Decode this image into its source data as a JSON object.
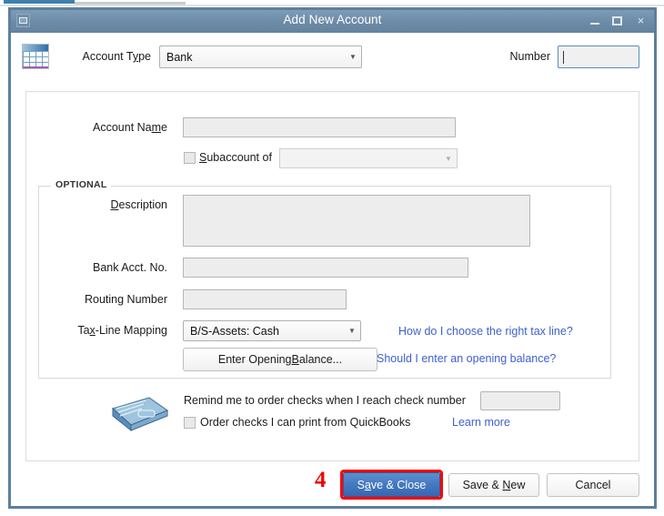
{
  "window": {
    "title": "Add New Account",
    "sysmenu_icon": "window-menu-icon",
    "minimize_icon": "minimize-icon",
    "maximize_icon": "maximize-icon",
    "close_icon": "close-icon",
    "close_glyph": "×"
  },
  "theme": {
    "titlebar_color": "#6d8ca8",
    "dialog_border": "#5d7f9c",
    "link_color": "#3f5fd0",
    "primary_button": "#4479c0",
    "annotation_color": "#ff0000"
  },
  "header": {
    "account_icon": "account-grid-icon",
    "account_type_label_pre": "Account T",
    "account_type_label_accel": "y",
    "account_type_label_post": "pe",
    "account_type_value": "Bank",
    "number_label": "Number",
    "number_value": ""
  },
  "form": {
    "account_name_label_pre": "Account Na",
    "account_name_label_accel": "m",
    "account_name_label_post": "e",
    "account_name_value": "",
    "subaccount_label_accel": "S",
    "subaccount_label_post": "ubaccount of",
    "subaccount_checked": false,
    "subaccount_value": "",
    "optional_legend": "OPTIONAL",
    "description_label_accel": "D",
    "description_label_post": "escription",
    "description_value": "",
    "bank_acct_label": "Bank Acct. No.",
    "bank_acct_value": "",
    "routing_label": "Routing Number",
    "routing_value": "",
    "taxline_label_pre": "Ta",
    "taxline_label_accel": "x",
    "taxline_label_post": "-Line Mapping",
    "taxline_value": "B/S-Assets: Cash",
    "taxline_link": "How do I choose the right tax line?",
    "opening_balance_button_pre": "Enter Opening ",
    "opening_balance_button_accel": "B",
    "opening_balance_button_post": "alance...",
    "opening_balance_link": "Should I enter an opening balance?"
  },
  "checks": {
    "check_icon": "checkbook-icon",
    "reminder_text": "Remind me to order checks when I reach check number",
    "check_number_value": "",
    "order_checks_label": "Order checks I can print from QuickBooks",
    "order_checks_checked": false,
    "learn_more_link": "Learn more"
  },
  "footer": {
    "annotation_number": "4",
    "save_close_pre": "S",
    "save_close_accel": "a",
    "save_close_post": "ve & Close",
    "save_new_pre": "Save & ",
    "save_new_accel": "N",
    "save_new_post": "ew",
    "cancel_label": "Cancel"
  }
}
